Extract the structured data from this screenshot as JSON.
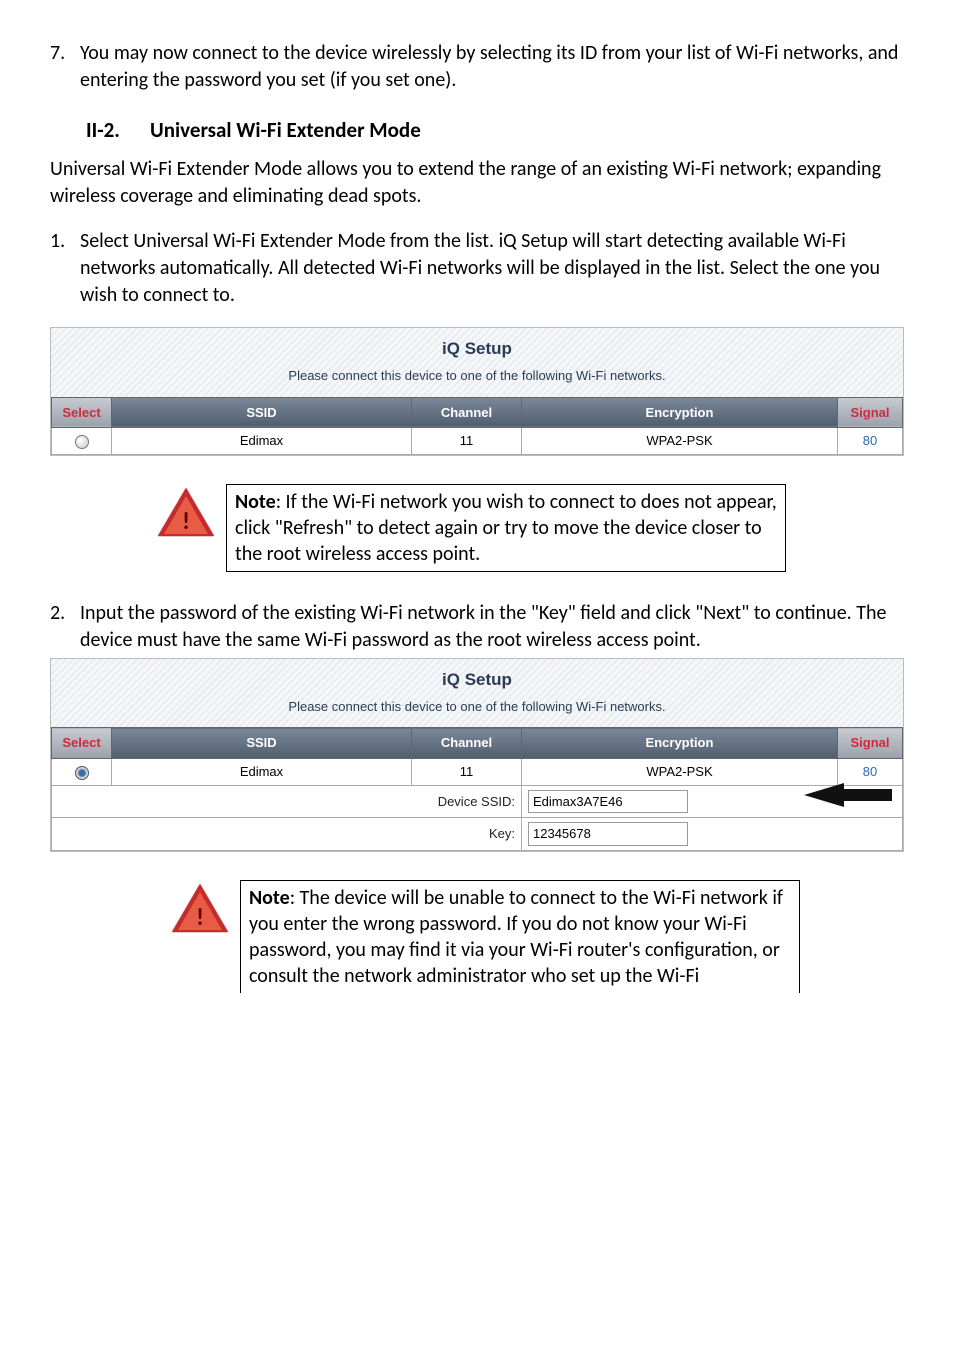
{
  "step7": {
    "num": "7.",
    "text": "You may now connect to the device wirelessly by selecting its ID from your list of Wi-Fi networks, and entering the password you set (if you set one)."
  },
  "heading": {
    "num": "II-2.",
    "text": "Universal Wi-Fi Extender Mode"
  },
  "intro": "Universal Wi-Fi Extender Mode allows you to extend the range of an existing Wi-Fi network; expanding wireless coverage and eliminating dead spots.",
  "step1": {
    "num": "1.",
    "text": "Select Universal Wi-Fi Extender Mode from the list. iQ Setup will start detecting available Wi-Fi networks automatically. All detected Wi-Fi networks will be displayed in the list. Select the one you wish to connect to."
  },
  "iq1": {
    "title": "iQ Setup",
    "sub": "Please connect this device to one of the following Wi-Fi networks.",
    "headers": {
      "select": "Select",
      "ssid": "SSID",
      "channel": "Channel",
      "enc": "Encryption",
      "signal": "Signal"
    },
    "row": {
      "ssid": "Edimax",
      "channel": "11",
      "enc": "WPA2-PSK",
      "signal": "80"
    }
  },
  "note1": {
    "label": "Note",
    "text": ": If the Wi-Fi network you wish to connect to does not appear, click \"Refresh\" to detect again or try to move the device closer to the root wireless access point."
  },
  "step2": {
    "num": "2.",
    "text": "Input the password of the existing Wi-Fi network in the \"Key\" field and click \"Next\" to continue. The device must have the same Wi-Fi password as the root wireless access point."
  },
  "iq2": {
    "title": "iQ Setup",
    "sub": "Please connect this device to one of the following Wi-Fi networks.",
    "headers": {
      "select": "Select",
      "ssid": "SSID",
      "channel": "Channel",
      "enc": "Encryption",
      "signal": "Signal"
    },
    "row": {
      "ssid": "Edimax",
      "channel": "11",
      "enc": "WPA2-PSK",
      "signal": "80"
    },
    "ssid_label": "Device SSID:",
    "ssid_value": "Edimax3A7E46",
    "key_label": "Key:",
    "key_value": "12345678"
  },
  "note2": {
    "label": "Note",
    "text": ": The device will be unable to connect to the Wi-Fi network if you enter the wrong password. If you do not know your Wi-Fi password, you may find it via your Wi-Fi router's configuration, or consult the network administrator who set up the Wi-Fi"
  }
}
